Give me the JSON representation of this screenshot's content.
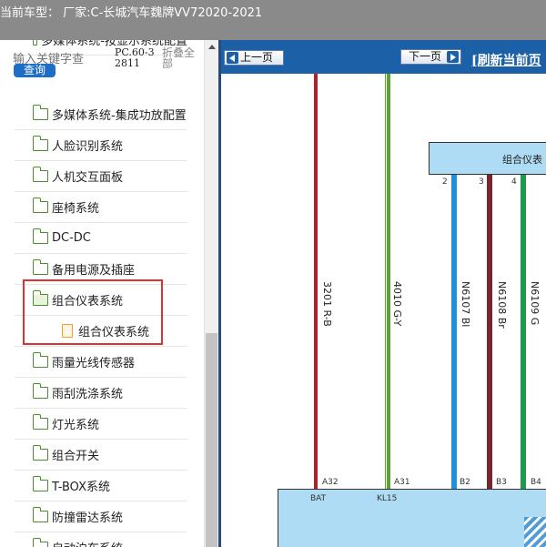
{
  "title_bar": {
    "text": "当前车型： 厂家:C-长城汽车魏牌VV72020-2021"
  },
  "search": {
    "placeholder": "输入关键字查",
    "button_label": "查询",
    "pc_code": "PC.60-32811",
    "collapse_all_label": "折叠全部"
  },
  "tree": {
    "partial_top_label": "多媒体系统-按显示系统配置",
    "items": [
      {
        "label": "多媒体系统-集成功放配置"
      },
      {
        "label": "人脸识别系统"
      },
      {
        "label": "人机交互面板"
      },
      {
        "label": "座椅系统"
      },
      {
        "label": "DC-DC"
      },
      {
        "label": "备用电源及插座"
      },
      {
        "label": "组合仪表系统",
        "expanded": true
      },
      {
        "label": "组合仪表系统",
        "type": "file"
      },
      {
        "label": "雨量光线传感器"
      },
      {
        "label": "雨刮洗涤系统"
      },
      {
        "label": "灯光系统"
      },
      {
        "label": "组合开关"
      },
      {
        "label": "T-BOX系统"
      },
      {
        "label": "防撞雷达系统"
      },
      {
        "label": "自动泊车系统"
      }
    ]
  },
  "toolbar": {
    "prev_label": "上一页",
    "next_label": "下一页",
    "refresh_label": "[刷新当前页"
  },
  "diagram": {
    "cluster_label": "组合仪表",
    "wires": [
      {
        "label": "3201 R-B",
        "pin": "A32",
        "signal": "BAT",
        "color": "#b3202a"
      },
      {
        "label": "4010 G-Y",
        "pin": "A31",
        "signal": "KL15",
        "color": "#5aa52c"
      },
      {
        "label": "N6107 Bl",
        "pin": "B2",
        "top_pin": "2",
        "color": "#2090d8"
      },
      {
        "label": "N6108 Br",
        "pin": "B3",
        "top_pin": "3",
        "color": "#7a2430"
      },
      {
        "label": "N6109 G",
        "pin": "B4",
        "top_pin": "4",
        "color": "#1e9a4a"
      }
    ]
  },
  "colors": {
    "title_bar": "#8a8a8a",
    "toolbar": "#1c60a8",
    "highlight": "#e03030",
    "folder_icon": "#4a8f2a",
    "file_icon": "#f0a030",
    "connector_fill": "#aedcf4"
  }
}
